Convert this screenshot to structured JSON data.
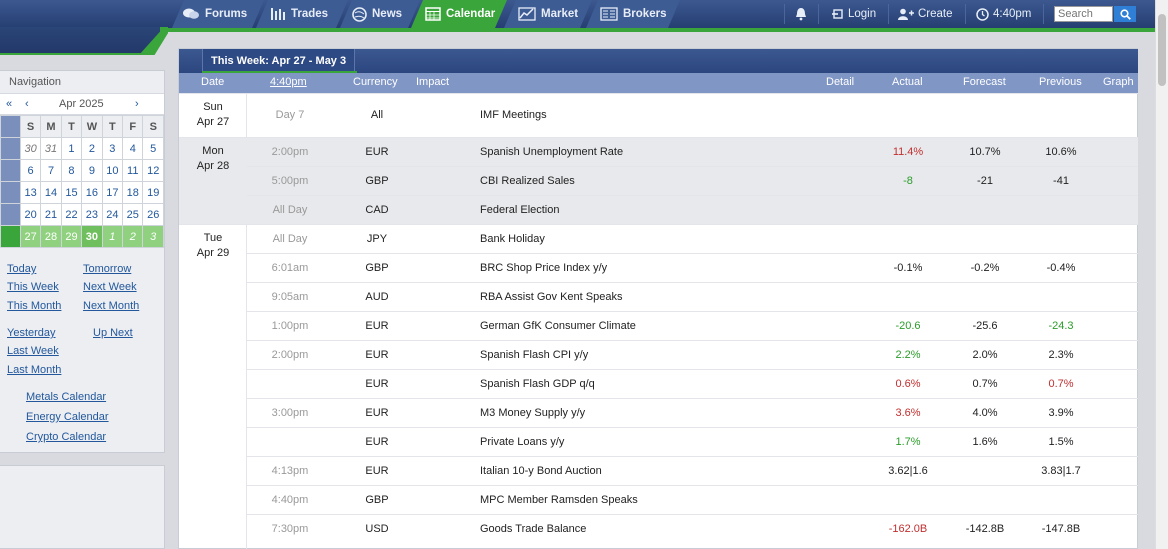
{
  "nav": {
    "tabs": [
      {
        "label": "Forums",
        "icon": "forums-icon"
      },
      {
        "label": "Trades",
        "icon": "trades-icon"
      },
      {
        "label": "News",
        "icon": "news-icon"
      },
      {
        "label": "Calendar",
        "icon": "calendar-icon",
        "active": true
      },
      {
        "label": "Market",
        "icon": "market-icon"
      },
      {
        "label": "Brokers",
        "icon": "brokers-icon"
      }
    ],
    "login": "Login",
    "create": "Create",
    "time": "4:40pm",
    "search_placeholder": "Search"
  },
  "sidebar": {
    "title": "Navigation",
    "month": "Apr 2025",
    "prev_prev": "«",
    "prev": "‹",
    "next": "›",
    "weekdays": [
      "S",
      "M",
      "T",
      "W",
      "T",
      "F",
      "S"
    ],
    "weeks": [
      [
        "30",
        "31",
        "1",
        "2",
        "3",
        "4",
        "5"
      ],
      [
        "6",
        "7",
        "8",
        "9",
        "10",
        "11",
        "12"
      ],
      [
        "13",
        "14",
        "15",
        "16",
        "17",
        "18",
        "19"
      ],
      [
        "20",
        "21",
        "22",
        "23",
        "24",
        "25",
        "26"
      ],
      [
        "27",
        "28",
        "29",
        "30",
        "1",
        "2",
        "3"
      ]
    ],
    "links": {
      "today": "Today",
      "tomorrow": "Tomorrow",
      "this_week": "This Week",
      "next_week": "Next Week",
      "this_month": "This Month",
      "next_month": "Next Month",
      "yesterday": "Yesterday",
      "up_next": "Up Next",
      "last_week": "Last Week",
      "last_month": "Last Month",
      "metals": "Metals Calendar",
      "energy": "Energy Calendar",
      "crypto": "Crypto Calendar"
    }
  },
  "calendar": {
    "week_label": "This Week: Apr 27 - May 3",
    "headers": {
      "date": "Date",
      "time": "4:40pm",
      "currency": "Currency",
      "impact": "Impact",
      "detail": "Detail",
      "actual": "Actual",
      "forecast": "Forecast",
      "previous": "Previous",
      "graph": "Graph"
    },
    "days": [
      {
        "dow": "Sun",
        "date": "Apr 27"
      },
      {
        "dow": "Mon",
        "date": "Apr 28"
      },
      {
        "dow": "Tue",
        "date": "Apr 29"
      }
    ],
    "events": [
      {
        "time": "Day 7",
        "currency": "All",
        "event": "IMF Meetings",
        "actual": "",
        "forecast": "",
        "previous": ""
      },
      {
        "time": "2:00pm",
        "currency": "EUR",
        "event": "Spanish Unemployment Rate",
        "actual": "11.4%",
        "forecast": "10.7%",
        "previous": "10.6%",
        "actual_color": "red"
      },
      {
        "time": "5:00pm",
        "currency": "GBP",
        "event": "CBI Realized Sales",
        "actual": "-8",
        "forecast": "-21",
        "previous": "-41",
        "actual_color": "green"
      },
      {
        "time": "All Day",
        "currency": "CAD",
        "event": "Federal Election",
        "actual": "",
        "forecast": "",
        "previous": ""
      },
      {
        "time": "All Day",
        "currency": "JPY",
        "event": "Bank Holiday",
        "actual": "",
        "forecast": "",
        "previous": ""
      },
      {
        "time": "6:01am",
        "currency": "GBP",
        "event": "BRC Shop Price Index y/y",
        "actual": "-0.1%",
        "forecast": "-0.2%",
        "previous": "-0.4%"
      },
      {
        "time": "9:05am",
        "currency": "AUD",
        "event": "RBA Assist Gov Kent Speaks",
        "actual": "",
        "forecast": "",
        "previous": ""
      },
      {
        "time": "1:00pm",
        "currency": "EUR",
        "event": "German GfK Consumer Climate",
        "actual": "-20.6",
        "forecast": "-25.6",
        "previous": "-24.3",
        "actual_color": "green",
        "previous_color": "green"
      },
      {
        "time": "2:00pm",
        "currency": "EUR",
        "event": "Spanish Flash CPI y/y",
        "actual": "2.2%",
        "forecast": "2.0%",
        "previous": "2.3%",
        "actual_color": "green"
      },
      {
        "time": "",
        "currency": "EUR",
        "event": "Spanish Flash GDP q/q",
        "actual": "0.6%",
        "forecast": "0.7%",
        "previous": "0.7%",
        "actual_color": "red",
        "previous_color": "red"
      },
      {
        "time": "3:00pm",
        "currency": "EUR",
        "event": "M3 Money Supply y/y",
        "actual": "3.6%",
        "forecast": "4.0%",
        "previous": "3.9%",
        "actual_color": "red"
      },
      {
        "time": "",
        "currency": "EUR",
        "event": "Private Loans y/y",
        "actual": "1.7%",
        "forecast": "1.6%",
        "previous": "1.5%",
        "actual_color": "green"
      },
      {
        "time": "4:13pm",
        "currency": "EUR",
        "event": "Italian 10-y Bond Auction",
        "actual": "3.62|1.6",
        "forecast": "",
        "previous": "3.83|1.7"
      },
      {
        "time": "4:40pm",
        "currency": "GBP",
        "event": "MPC Member Ramsden Speaks",
        "actual": "",
        "forecast": "",
        "previous": ""
      },
      {
        "time": "7:30pm",
        "currency": "USD",
        "event": "Goods Trade Balance",
        "actual": "-162.0B",
        "forecast": "-142.8B",
        "previous": "-147.8B",
        "actual_color": "red"
      }
    ]
  },
  "colors": {
    "nav_blue": "#2c4780",
    "accent_green": "#3aa53a",
    "link_blue": "#23589c",
    "negative_red": "#c12f2f",
    "positive_green": "#2a9d2a"
  }
}
